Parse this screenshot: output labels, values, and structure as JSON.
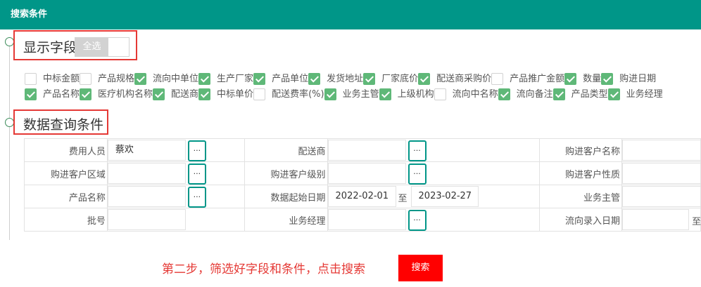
{
  "header": {
    "title": "搜索条件"
  },
  "display_fields": {
    "title": "显示字段",
    "select_all_label": "全选",
    "row1": [
      {
        "label": "中标金额",
        "checked": false
      },
      {
        "label": "产品规格",
        "checked": true
      },
      {
        "label": "流向中单位",
        "checked": true
      },
      {
        "label": "生产厂家",
        "checked": true
      },
      {
        "label": "产品单位",
        "checked": true
      },
      {
        "label": "发货地址",
        "checked": true
      },
      {
        "label": "厂家底价",
        "checked": true
      },
      {
        "label": "配送商采购价",
        "checked": false
      },
      {
        "label": "产品推广金额",
        "checked": true
      },
      {
        "label": "数量",
        "checked": true
      },
      {
        "label": "购进日期",
        "checked": true
      }
    ],
    "row2": [
      {
        "label": "产品名称",
        "checked": true
      },
      {
        "label": "医疗机构名称",
        "checked": true
      },
      {
        "label": "配送商",
        "checked": true
      },
      {
        "label": "中标单价",
        "checked": false
      },
      {
        "label": "配送费率(%)",
        "checked": true
      },
      {
        "label": "业务主管",
        "checked": true
      },
      {
        "label": "上级机构",
        "checked": false
      },
      {
        "label": "流向中名称",
        "checked": true
      },
      {
        "label": "流向备注",
        "checked": true
      },
      {
        "label": "产品类型",
        "checked": true
      },
      {
        "label": "业务经理",
        "checked": true
      }
    ]
  },
  "query": {
    "title": "数据查询条件",
    "dots_label": "...",
    "to_label": "至",
    "fee_person": {
      "label": "费用人员",
      "value": "蔡欢"
    },
    "distributor": {
      "label": "配送商",
      "value": ""
    },
    "buyer_name": {
      "label": "购进客户名称",
      "value": ""
    },
    "buyer_region": {
      "label": "购进客户区域",
      "value": ""
    },
    "buyer_level": {
      "label": "购进客户级别",
      "value": ""
    },
    "buyer_nature": {
      "label": "购进客户性质",
      "value": ""
    },
    "product_name": {
      "label": "产品名称",
      "value": ""
    },
    "date_range": {
      "label": "数据起始日期",
      "start": "2022-02-01",
      "end": "2023-02-27"
    },
    "supervisor": {
      "label": "业务主管",
      "value": ""
    },
    "batch_no": {
      "label": "批号",
      "value": ""
    },
    "manager": {
      "label": "业务经理",
      "value": ""
    },
    "flow_entry_date": {
      "label": "流向录入日期",
      "value": ""
    }
  },
  "footer": {
    "hint": "第二步，筛选好字段和条件，点击搜索",
    "search_button": "搜索"
  }
}
